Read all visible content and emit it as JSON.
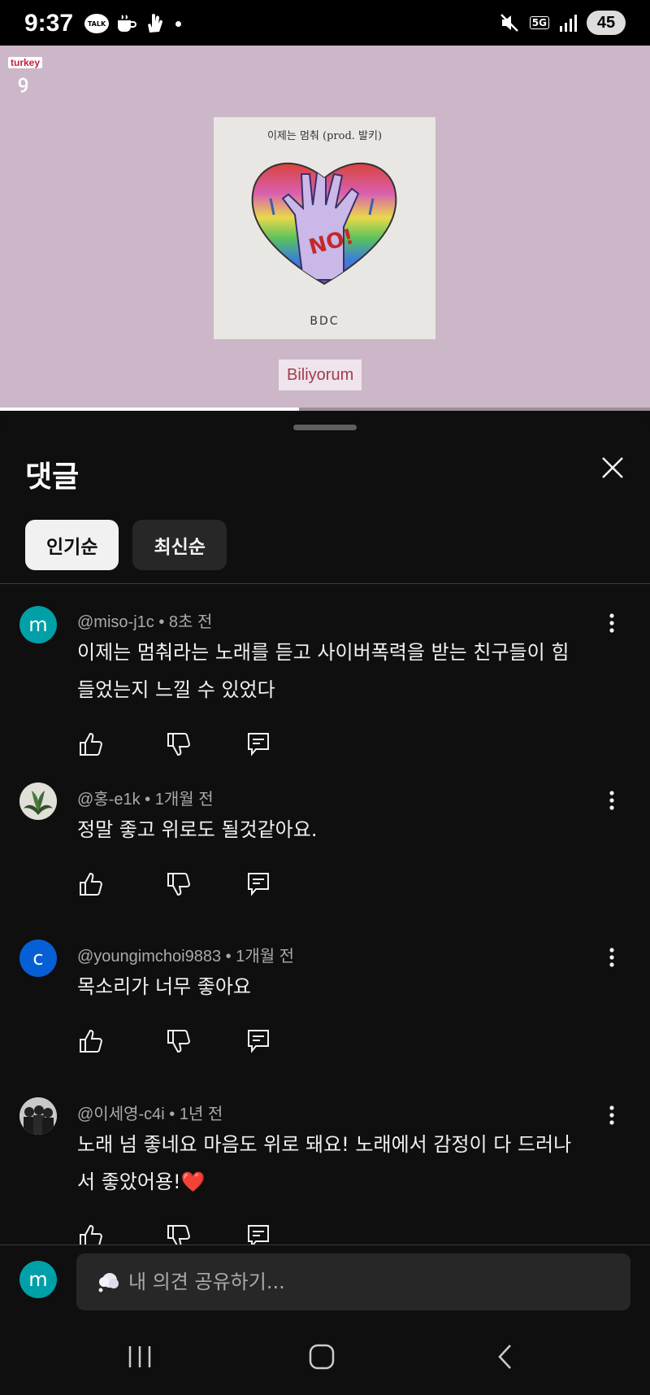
{
  "status_bar": {
    "time": "9:37",
    "talk_label": "TALK",
    "network": "5G",
    "battery": "45"
  },
  "video": {
    "channel_logo_tag": "turkey",
    "album_title": "이제는 멈춰 (prod. 발키)",
    "album_artist": "BDC",
    "album_badge": "NO!",
    "subtitle": "Biliyorum",
    "progress": 0.46
  },
  "comments_panel": {
    "title": "댓글",
    "sort_chips": [
      {
        "label": "인기순",
        "active": true
      },
      {
        "label": "최신순",
        "active": false
      }
    ],
    "comments": [
      {
        "avatar_letter": "m",
        "avatar_color": "#00a0a8",
        "meta": "@miso-j1c • 8초 전",
        "text": "이제는 멈춰라는 노래를 듣고 사이버폭력을 받는 친구들이 힘들었는지 느낄 수 있었다"
      },
      {
        "avatar_letter": "",
        "avatar_color": "#3f5a3a",
        "meta": "@홍-e1k • 1개월 전",
        "text": "정말 좋고 위로도 될것같아요."
      },
      {
        "avatar_letter": "c",
        "avatar_color": "#065fd4",
        "meta": "@youngimchoi9883 • 1개월 전",
        "text": "목소리가 너무 좋아요"
      },
      {
        "avatar_letter": "",
        "avatar_color": "#5a5a5a",
        "meta": "@이세영-c4i • 1년 전",
        "text": "노래 넘 좋네요 마음도 위로 돼요! 노래에서 감정이 다 드러나서 좋았어용!❤️"
      }
    ],
    "composer": {
      "avatar_letter": "m",
      "placeholder": "내 의견 공유하기..."
    }
  },
  "icons": {
    "close": "close-icon",
    "like": "thumb-up-icon",
    "dislike": "thumb-down-icon",
    "reply": "reply-icon",
    "more": "more-vert-icon"
  },
  "colors": {
    "video_bg": "#cbb7c8",
    "panel_bg": "#0f0f0f",
    "subtitle_text": "#a23c4f"
  }
}
